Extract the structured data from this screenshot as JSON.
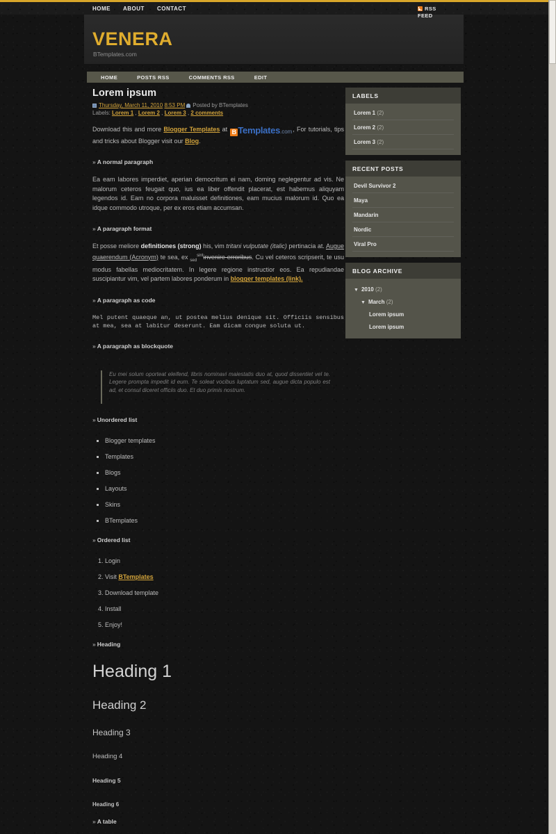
{
  "topbar": {
    "nav": [
      {
        "label": "HOME"
      },
      {
        "label": "ABOUT"
      },
      {
        "label": "CONTACT"
      }
    ],
    "rss_label": "RSS",
    "feed_label": "FEED"
  },
  "masthead": {
    "title": "VENERA",
    "description": "BTemplates.com"
  },
  "mainnav": [
    {
      "label": "HOME"
    },
    {
      "label": "POSTS RSS"
    },
    {
      "label": "COMMENTS RSS"
    },
    {
      "label": "EDIT"
    }
  ],
  "post": {
    "title": "Lorem ipsum",
    "date": "Thursday, March 11, 2010",
    "time": "8:53 PM",
    "author_prefix": "Posted by",
    "author": "BTemplates",
    "labels_prefix": "Labels:",
    "labels": [
      {
        "label": "Lorem 1"
      },
      {
        "label": "Lorem 2"
      },
      {
        "label": "Lorem 3"
      }
    ],
    "comments": "2 comments",
    "intro": {
      "part1": "Download this and more ",
      "link1": "Blogger Templates",
      "part2": " at ",
      "logo_b": "B",
      "logo_templates": "Templates",
      "logo_com": ".com",
      "part3": ", For tutorials, tips and tricks about Blogger visit our ",
      "link2": "Blog",
      "part4": "."
    },
    "sections": {
      "normal_paragraph_heading": "A normal paragraph",
      "normal_paragraph_text": "Ea eam labores imperdiet, aperian democritum ei nam, doming neglegentur ad vis. Ne malorum ceteros feugait quo, ius ea liber offendit placerat, est habemus aliquyam legendos id. Eam no corpora maluisset definitiones, eam mucius malorum id. Quo ea idque commodo utroque, per ex eros etiam accumsan.",
      "format_heading": "A paragraph format",
      "format_p1": "Et posse meliore ",
      "format_strong": "definitiones (strong)",
      "format_p2": " his, vim ",
      "format_italic": "tritani vulputate (italic)",
      "format_p3": " pertinacia at. ",
      "format_acronym": "Augue quaerendum (Acronym)",
      "format_p4": " te sea, ex ",
      "format_sub": "sed",
      "format_sup": "sint",
      "format_strike": "invenire erroribus",
      "format_p5": ". Cu vel ceteros scripserit, te usu modus fabellas mediocritatem. In legere regione instructior eos. Ea repudiandae suscipiantur vim, vel partem labores ponderum in ",
      "format_link": "blogger templates (link).",
      "code_heading": "A paragraph as code",
      "code_text": "Mel putent quaeque an, ut postea melius denique sit. Officiis sensibus at mea, sea at labitur deserunt. Eam dicam congue soluta ut.",
      "blockquote_heading": "A paragraph as blockquote",
      "blockquote_text": "Eu mei solum oporteat eleifend, libris nominavi maiestatis duo at, quod dissentiet vel te. Legere prompta impedit id eum. Te soleat vocibus luptatum sed, augue dicta populo est ad, et consul diceret officiis duo. Et duo primis nostrum.",
      "ul_heading": "Unordered list",
      "ul_items": [
        {
          "label": "Blogger templates"
        },
        {
          "label": "Templates"
        },
        {
          "label": "Blogs"
        },
        {
          "label": "Layouts"
        },
        {
          "label": "Skins"
        },
        {
          "label": "BTemplates"
        }
      ],
      "ol_heading": "Ordered list",
      "ol_items": [
        {
          "label": "Login"
        },
        {
          "label": "Visit ",
          "link": "BTemplates"
        },
        {
          "label": "Download template"
        },
        {
          "label": "Install"
        },
        {
          "label": "Enjoy!"
        }
      ],
      "heading_heading": "Heading",
      "h1": "Heading 1",
      "h2": "Heading 2",
      "h3": "Heading 3",
      "h4": "Heading 4",
      "h5": "Heading 5",
      "h6": "Heading 6",
      "table_heading": "A table"
    }
  },
  "sidebar": {
    "labels_widget": {
      "title": "LABELS",
      "items": [
        {
          "label": "Lorem 1",
          "count": "(2)"
        },
        {
          "label": "Lorem 2",
          "count": "(2)"
        },
        {
          "label": "Lorem 3",
          "count": "(2)"
        }
      ]
    },
    "recent_posts_widget": {
      "title": "RECENT POSTS",
      "items": [
        {
          "label": "Devil Survivor 2"
        },
        {
          "label": "Maya"
        },
        {
          "label": "Mandarin"
        },
        {
          "label": "Nordic"
        },
        {
          "label": "Viral Pro"
        }
      ]
    },
    "archive_widget": {
      "title": "BLOG ARCHIVE",
      "year": "2010",
      "year_count": "(2)",
      "month": "March",
      "month_count": "(2)",
      "posts": [
        {
          "label": "Lorem ipsum"
        },
        {
          "label": "Lorem ipsum"
        }
      ]
    }
  },
  "icons": {
    "rss": "rss-icon",
    "calendar": "calendar-icon",
    "user": "user-icon",
    "triangle_down": "▼",
    "chevron": "»"
  },
  "colors": {
    "gold": "#d8a62a",
    "link_gold": "#d2a33b",
    "nav_olive": "#57574a",
    "widget_bg": "#54544a",
    "page_bg": "#141414",
    "rss_orange": "#e87b1e",
    "logo_blue": "#3b6fc4"
  }
}
